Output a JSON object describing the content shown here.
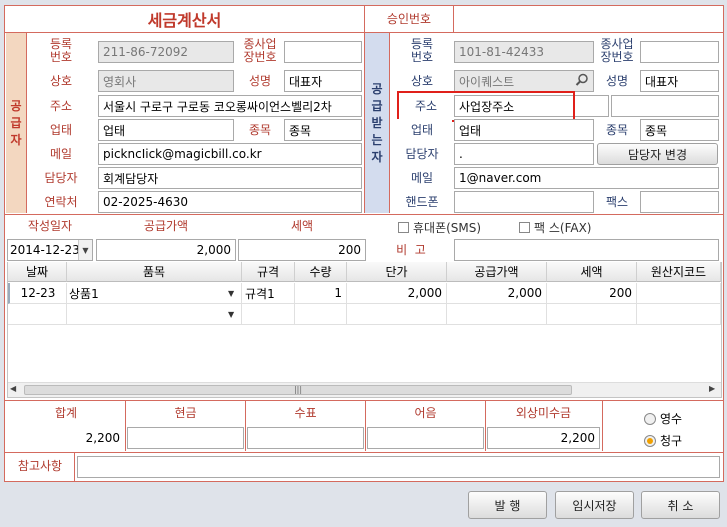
{
  "title": "세금계산서",
  "approval_label": "승인번호",
  "approval_value": "",
  "supplier": {
    "side_label": [
      "공",
      "급",
      "자"
    ],
    "reg_no_label": "등록\n번호",
    "reg_no": "211-86-72092",
    "sub_biz_label": "종사업\n장번호",
    "sub_biz": "",
    "name_label": "상호",
    "name": "영회사",
    "rep_label": "성명",
    "rep": "대표자",
    "addr_label": "주소",
    "addr": "서울시 구로구 구로동 코오롱싸이언스벨리2차",
    "biztype_label": "업태",
    "biztype": "업태",
    "item_label": "종목",
    "item": "종목",
    "email_label": "메일",
    "email": "pickncIick@magicbill.co.kr",
    "manager_label": "담당자",
    "manager": "회계담당자",
    "contact_label": "연락처",
    "contact": "02-2025-4630"
  },
  "receiver": {
    "side_label": [
      "공",
      "급",
      "받",
      "는",
      "자"
    ],
    "reg_no_label": "등록\n번호",
    "reg_no": "101-81-42433",
    "sub_biz_label": "종사업\n장번호",
    "sub_biz": "",
    "name_label": "상호",
    "name": "아이퀘스트",
    "rep_label": "성명",
    "rep": "대표자",
    "addr_label": "주소",
    "addr": "사업장주소",
    "biztype_label": "업태",
    "biztype": "업태",
    "item_label": "종목",
    "item": "종목",
    "manager_label": "담당자",
    "manager": ".",
    "change_manager_btn": "담당자 변경",
    "email_label": "메일",
    "email": "1@naver.com",
    "phone_label": "핸드폰",
    "phone": "",
    "fax_label": "팩스",
    "fax": ""
  },
  "summary": {
    "date_label": "작성일자",
    "date": "2014-12-23",
    "supply_label": "공급가액",
    "supply": "2,000",
    "tax_label": "세액",
    "tax": "200",
    "sms_label": "휴대폰(SMS)",
    "fax_label": "팩 스(FAX)",
    "note_label": "비  고",
    "note": ""
  },
  "grid": {
    "headers": [
      "날짜",
      "품목",
      "규격",
      "수량",
      "단가",
      "공급가액",
      "세액",
      "원산지코드"
    ],
    "rows": [
      [
        "12-23",
        "상품1",
        "규격1",
        "1",
        "2,000",
        "2,000",
        "200",
        ""
      ]
    ]
  },
  "totals": {
    "labels": [
      "합계",
      "현금",
      "수표",
      "어음",
      "외상미수금"
    ],
    "values": [
      "2,200",
      "",
      "",
      "",
      "2,200"
    ],
    "receipt_label": "영수",
    "claim_label": "청구",
    "selected": "청구"
  },
  "memo_label": "참고사항",
  "memo": "",
  "buttons": {
    "issue": "발 행",
    "temp_save": "임시저장",
    "cancel": "취 소"
  },
  "colors": {
    "accent": "#d46a5e",
    "label_red": "#b03a2e",
    "label_blue": "#2b3f6e",
    "highlight": "#e0201a"
  }
}
